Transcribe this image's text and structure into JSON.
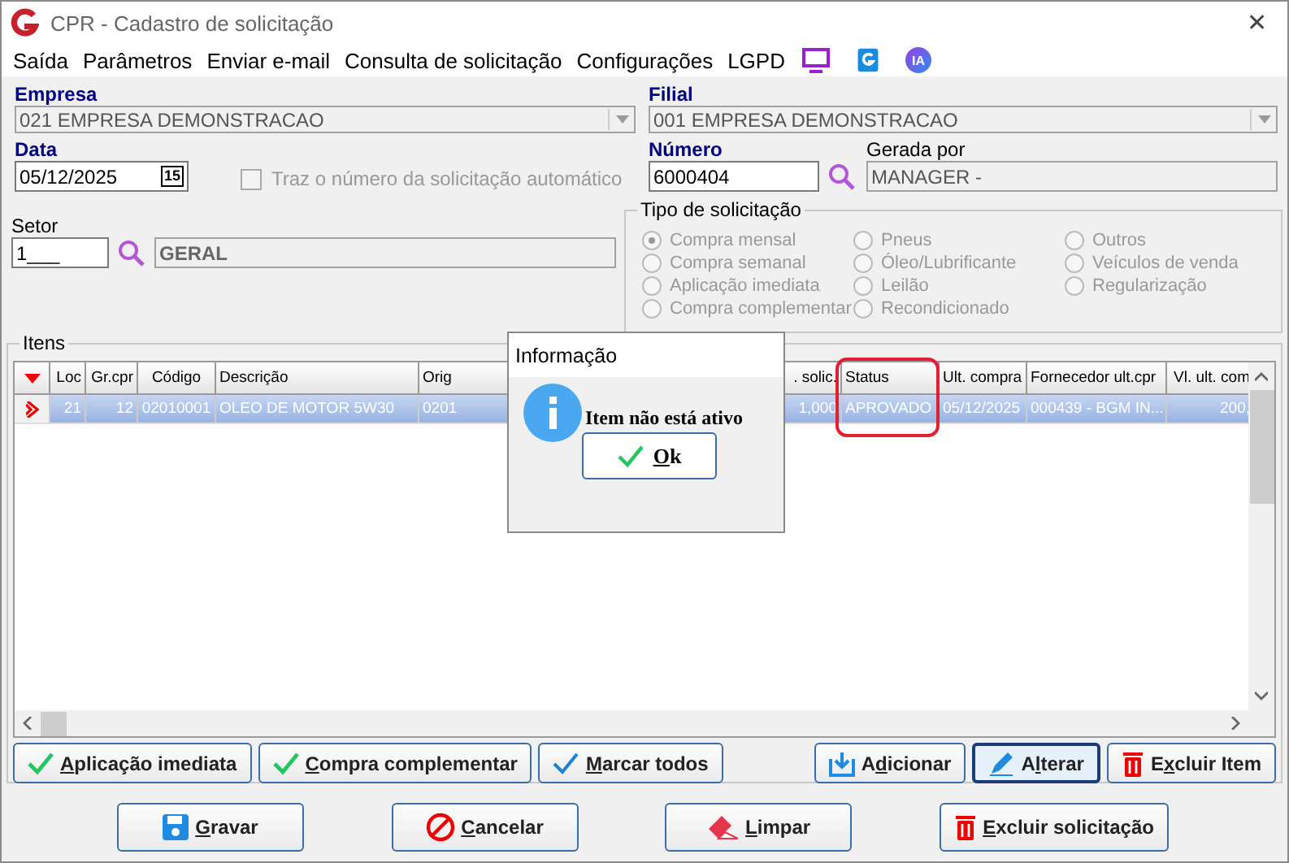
{
  "window": {
    "title": "CPR - Cadastro de solicitação",
    "close": "✕"
  },
  "menu": [
    {
      "label": "Saída"
    },
    {
      "label": "Parâmetros"
    },
    {
      "label": "Enviar e-mail"
    },
    {
      "label": "Consulta de solicitação"
    },
    {
      "label": "Configurações"
    },
    {
      "label": "LGPD"
    }
  ],
  "menu_badge": "IA",
  "empresa": {
    "label": "Empresa",
    "value": "021 EMPRESA DEMONSTRACAO"
  },
  "filial": {
    "label": "Filial",
    "value": "001 EMPRESA DEMONSTRACAO"
  },
  "data": {
    "label": "Data",
    "value": "05/12/2025",
    "calendar": "15"
  },
  "auto_number": {
    "label": "Traz o número da solicitação automático",
    "checked": false,
    "disabled": true
  },
  "numero": {
    "label": "Número",
    "value": "6000404"
  },
  "gerada_por": {
    "label": "Gerada por",
    "value": "MANAGER -"
  },
  "setor": {
    "label": "Setor",
    "code": "1___",
    "name": "GERAL"
  },
  "tipo": {
    "title": "Tipo de solicitação",
    "options": [
      {
        "label": "Compra mensal",
        "selected": true
      },
      {
        "label": "Compra semanal",
        "selected": false
      },
      {
        "label": "Aplicação imediata",
        "selected": false
      },
      {
        "label": "Compra complementar",
        "selected": false
      },
      {
        "label": "Pneus",
        "selected": false
      },
      {
        "label": "Óleo/Lubrificante",
        "selected": false
      },
      {
        "label": "Leilão",
        "selected": false
      },
      {
        "label": "Recondicionado",
        "selected": false
      },
      {
        "label": "Outros",
        "selected": false
      },
      {
        "label": "Veículos de venda",
        "selected": false
      },
      {
        "label": "Regularização",
        "selected": false
      }
    ]
  },
  "itens": {
    "title": "Itens",
    "columns": [
      "Loc",
      "Gr.cpr",
      "Código",
      "Descrição",
      "Orig",
      ". solic.",
      "Status",
      "Ult. compra",
      "Fornecedor ult.cpr",
      "Vl. ult. com"
    ],
    "rows": [
      {
        "selected": true,
        "cells": [
          "21",
          "12",
          "02010001",
          "OLEO DE MOTOR 5W30",
          "0201",
          "1,000",
          "APROVADO",
          "05/12/2025",
          "000439 - BGM IN...",
          "200,"
        ]
      }
    ],
    "buttons": [
      {
        "kind": "check",
        "key": "A",
        "post": "plicação imediata",
        "focused": false
      },
      {
        "kind": "check",
        "key": "C",
        "post": "ompra complementar",
        "focused": false
      },
      {
        "kind": "tick",
        "key": "M",
        "post": "arcar todos",
        "focused": false
      },
      {
        "kind": "download",
        "pre": "A",
        "key": "d",
        "post": "icionar",
        "focused": false
      },
      {
        "kind": "pencil",
        "pre": "A",
        "key": "l",
        "post": "terar",
        "focused": true
      },
      {
        "kind": "trash",
        "pre": "E",
        "key": "x",
        "post": "cluir Item",
        "focused": false
      }
    ]
  },
  "buttons": [
    {
      "kind": "save",
      "key": "G",
      "post": "ravar",
      "focused": false
    },
    {
      "kind": "cancel",
      "key": "C",
      "post": "ancelar",
      "focused": false
    },
    {
      "kind": "eraser",
      "key": "L",
      "post": "impar",
      "focused": false
    },
    {
      "kind": "trash",
      "key": "E",
      "post": "xcluir solicitação",
      "focused": false
    }
  ],
  "dialog": {
    "title": "Informação",
    "message": "Item não está ativo",
    "button": {
      "key": "O",
      "post": "k"
    }
  }
}
